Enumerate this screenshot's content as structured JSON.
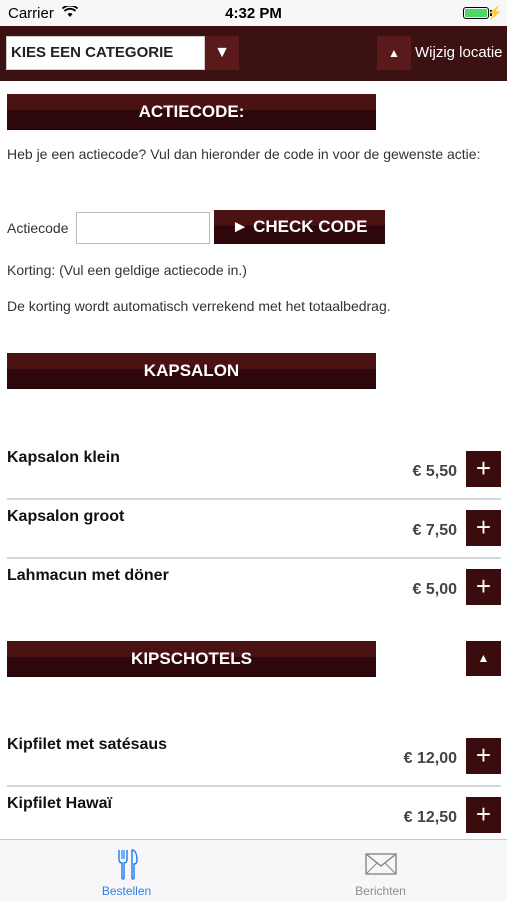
{
  "status_bar": {
    "carrier": "Carrier",
    "time": "4:32 PM"
  },
  "top_bar": {
    "category_select": "KIES EEN CATEGORIE",
    "location_label": "Wijzig locatie"
  },
  "promo": {
    "header": "ACTIECODE:",
    "intro": "Heb je een actiecode? Vul dan hieronder de code in voor de gewenste actie:",
    "input_label": "Actiecode",
    "input_value": "",
    "button_label": "► CHECK CODE",
    "discount_text": "Korting: (Vul een geldige actiecode in.)",
    "note": "De korting wordt automatisch verrekend met het totaalbedrag."
  },
  "categories": [
    {
      "title": "KAPSALON",
      "items": [
        {
          "name": "Kapsalon klein",
          "price": "€ 5,50"
        },
        {
          "name": "Kapsalon groot",
          "price": "€ 7,50"
        },
        {
          "name": "Lahmacun met döner",
          "price": "€ 5,00"
        }
      ]
    },
    {
      "title": "KIPSCHOTELS",
      "collapse_icon": "▲",
      "items": [
        {
          "name": "Kipfilet met satésaus",
          "price": "€ 12,00"
        },
        {
          "name": "Kipfilet Hawaï",
          "price": "€ 12,50"
        }
      ]
    }
  ],
  "tab_bar": {
    "tabs": [
      {
        "label": "Bestellen",
        "icon": "fork-knife-icon",
        "active": true
      },
      {
        "label": "Berichten",
        "icon": "envelope-icon",
        "active": false
      }
    ]
  },
  "colors": {
    "brand_dark": "#3b1112",
    "accent_blue": "#2b82f0"
  }
}
